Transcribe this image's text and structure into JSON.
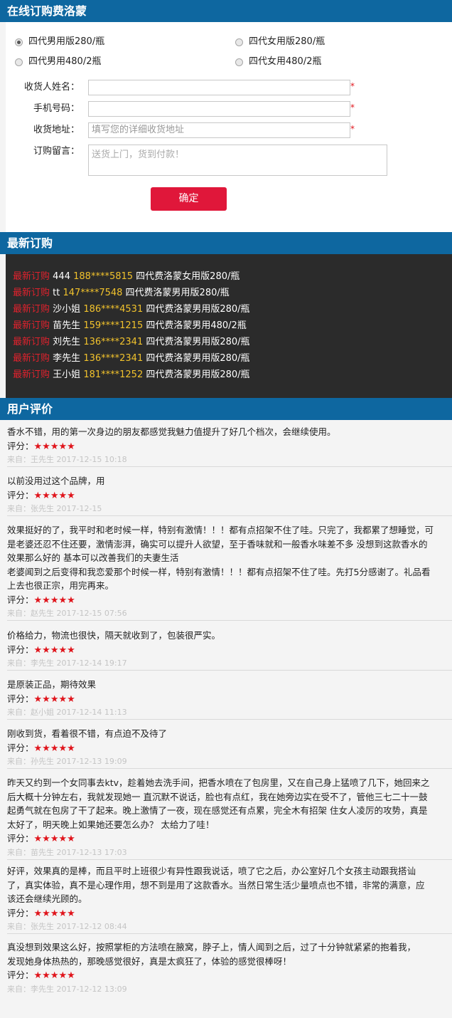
{
  "order_form": {
    "title": "在线订购费洛蒙",
    "options": [
      {
        "label": "四代男用版280/瓶",
        "checked": true
      },
      {
        "label": "四代女用版280/瓶",
        "checked": false
      },
      {
        "label": "四代男用480/2瓶",
        "checked": false
      },
      {
        "label": "四代女用480/2瓶",
        "checked": false
      }
    ],
    "fields": {
      "name_label": "收货人姓名：",
      "phone_label": "手机号码：",
      "address_label": "收货地址：",
      "address_placeholder": "填写您的详细收货地址",
      "message_label": "订购留言：",
      "message_value": "送货上门，货到付款！",
      "required_mark": "*"
    },
    "confirm_label": "确定"
  },
  "latest_orders": {
    "title": "最新订购",
    "tag": "最新订购",
    "rows": [
      {
        "name": "444",
        "phone": "188****5815",
        "product": "四代费洛蒙女用版280/瓶"
      },
      {
        "name": "tt",
        "phone": "147****7548",
        "product": "四代费洛蒙男用版280/瓶"
      },
      {
        "name": "沙小姐",
        "phone": "186****4531",
        "product": "四代费洛蒙男用版280/瓶"
      },
      {
        "name": "苗先生",
        "phone": "159****1215",
        "product": "四代费洛蒙男用480/2瓶"
      },
      {
        "name": "刘先生",
        "phone": "136****2341",
        "product": "四代费洛蒙男用版280/瓶"
      },
      {
        "name": "李先生",
        "phone": "136****2341",
        "product": "四代费洛蒙男用版280/瓶"
      },
      {
        "name": "王小姐",
        "phone": "181****1252",
        "product": "四代费洛蒙男用版280/瓶"
      }
    ]
  },
  "reviews": {
    "title": "用户评价",
    "rating_label": "评分：",
    "stars": "★★★★★",
    "items": [
      {
        "lines": [
          "香水不错，用的第一次身边的朋友都感觉我魅力值提升了好几个档次，会继续使用。"
        ],
        "source": "来自：王先生 2017-12-15 10:18"
      },
      {
        "lines": [
          "以前没用过这个品牌，用"
        ],
        "source": "来自：张先生 2017-12-15"
      },
      {
        "lines": [
          "效果挺好的了，我平时和老时候一样，特别有激情！！！都有点招架不住了哇。只完了，我都累了想睡觉，可",
          "是老婆还忍不住还要，激情澎湃，确实可以提升人欲望，至于香味就和一般香水味差不多 没想到这款香水的",
          "效果那么好的 基本可以改善我们的夫妻生活",
          "老婆闻到之后变得和我恋爱那个时候一样，特别有激情！！！都有点招架不住了哇。先打5分感谢了。礼品看",
          "上去也很正宗，用完再来。"
        ],
        "source": "来自：赵先生 2017-12-15 07:56"
      },
      {
        "lines": [
          "价格给力，物流也很快，隔天就收到了，包装很严实。"
        ],
        "source": "来自：李先生 2017-12-14 19:17"
      },
      {
        "lines": [
          "是原装正品，期待效果"
        ],
        "source": "来自：赵小姐 2017-12-14 11:13"
      },
      {
        "lines": [
          "刚收到货，看着很不错，有点迫不及待了"
        ],
        "source": "来自：孙先生 2017-12-13 19:09"
      },
      {
        "lines": [
          "昨天又约到一个女同事去ktv，趁着她去洗手间，把香水喷在了包房里，又在自己身上猛喷了几下，她回来之",
          "后大概十分钟左右，我就发现她一 直沉默不说话，脸也有点红，我在她旁边实在受不了，管他三七二十一鼓",
          "起勇气就在包房了干了起来。晚上激情了一夜，现在感觉还有点累，完全木有招架 住女人凌厉的攻势，真是",
          "太好了，明天晚上如果她还要怎么办？ 太给力了哇！"
        ],
        "source": "来自：苗先生 2017-12-13 17:03"
      },
      {
        "lines": [
          "好评，效果真的是棒，而且平时上班很少有异性跟我说话，喷了它之后，办公室好几个女孩主动跟我搭讪",
          "了，真实体验，真不是心理作用，想不到是用了这款香水。当然日常生活少量喷点也不错，非常的满意，应",
          "该还会继续光顾的。"
        ],
        "source": "来自：张先生 2017-12-12 08:44"
      },
      {
        "lines": [
          "真没想到效果这么好，按照掌柜的方法喷在腋窝，脖子上，情人闻到之后，过了十分钟就紧紧的抱着我，",
          "发现她身体热热的，那晚感觉很好，真是太疯狂了，体验的感觉很棒呀！"
        ],
        "source": "来自：李先生 2017-12-12 13:09"
      }
    ]
  }
}
